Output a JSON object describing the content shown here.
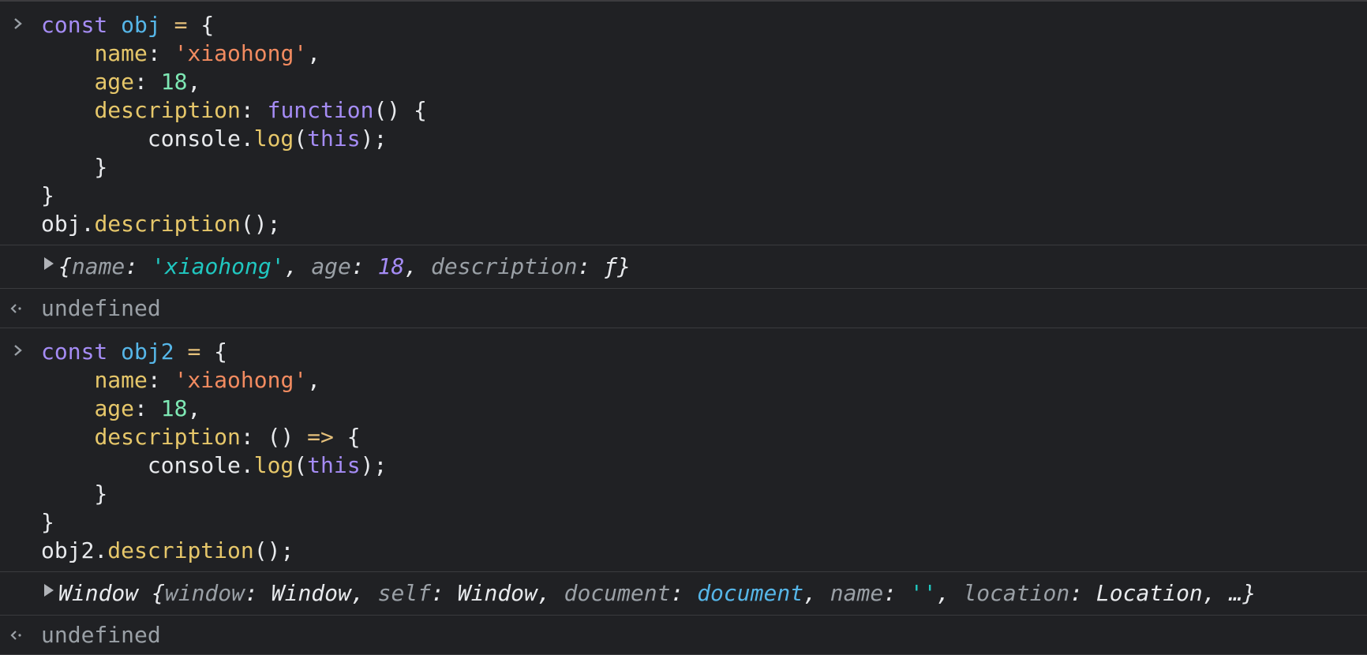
{
  "entries": [
    {
      "kind": "input",
      "lines": [
        [
          {
            "t": "const ",
            "c": "kw"
          },
          {
            "t": "obj",
            "c": "var"
          },
          {
            "t": " = ",
            "c": "op"
          },
          {
            "t": "{",
            "c": "plain"
          }
        ],
        [
          {
            "t": "    ",
            "c": "plain"
          },
          {
            "t": "name",
            "c": "prop"
          },
          {
            "t": ": ",
            "c": "plain"
          },
          {
            "t": "'xiaohong'",
            "c": "str"
          },
          {
            "t": ",",
            "c": "plain"
          }
        ],
        [
          {
            "t": "    ",
            "c": "plain"
          },
          {
            "t": "age",
            "c": "prop"
          },
          {
            "t": ": ",
            "c": "plain"
          },
          {
            "t": "18",
            "c": "num"
          },
          {
            "t": ",",
            "c": "plain"
          }
        ],
        [
          {
            "t": "    ",
            "c": "plain"
          },
          {
            "t": "description",
            "c": "prop"
          },
          {
            "t": ": ",
            "c": "plain"
          },
          {
            "t": "function",
            "c": "kw"
          },
          {
            "t": "() {",
            "c": "plain"
          }
        ],
        [
          {
            "t": "        console.",
            "c": "plain"
          },
          {
            "t": "log",
            "c": "fn"
          },
          {
            "t": "(",
            "c": "plain"
          },
          {
            "t": "this",
            "c": "this"
          },
          {
            "t": ");",
            "c": "plain"
          }
        ],
        [
          {
            "t": "    }",
            "c": "plain"
          }
        ],
        [
          {
            "t": "}",
            "c": "plain"
          }
        ],
        [
          {
            "t": "obj.",
            "c": "plain"
          },
          {
            "t": "description",
            "c": "fn"
          },
          {
            "t": "();",
            "c": "plain"
          }
        ]
      ]
    },
    {
      "kind": "log",
      "tokens": [
        {
          "t": "{",
          "c": "plain"
        },
        {
          "t": "name",
          "c": "pkey"
        },
        {
          "t": ": ",
          "c": "plain"
        },
        {
          "t": "'xiaohong'",
          "c": "pstr"
        },
        {
          "t": ", ",
          "c": "plain"
        },
        {
          "t": "age",
          "c": "pkey"
        },
        {
          "t": ": ",
          "c": "plain"
        },
        {
          "t": "18",
          "c": "pnum"
        },
        {
          "t": ", ",
          "c": "plain"
        },
        {
          "t": "description",
          "c": "pkey"
        },
        {
          "t": ": ",
          "c": "plain"
        },
        {
          "t": "ƒ",
          "c": "plain"
        },
        {
          "t": "}",
          "c": "plain"
        }
      ]
    },
    {
      "kind": "result",
      "text": "undefined"
    },
    {
      "kind": "input",
      "lines": [
        [
          {
            "t": "const ",
            "c": "kw"
          },
          {
            "t": "obj2",
            "c": "var"
          },
          {
            "t": " = ",
            "c": "op"
          },
          {
            "t": "{",
            "c": "plain"
          }
        ],
        [
          {
            "t": "    ",
            "c": "plain"
          },
          {
            "t": "name",
            "c": "prop"
          },
          {
            "t": ": ",
            "c": "plain"
          },
          {
            "t": "'xiaohong'",
            "c": "str"
          },
          {
            "t": ",",
            "c": "plain"
          }
        ],
        [
          {
            "t": "    ",
            "c": "plain"
          },
          {
            "t": "age",
            "c": "prop"
          },
          {
            "t": ": ",
            "c": "plain"
          },
          {
            "t": "18",
            "c": "num"
          },
          {
            "t": ",",
            "c": "plain"
          }
        ],
        [
          {
            "t": "    ",
            "c": "plain"
          },
          {
            "t": "description",
            "c": "prop"
          },
          {
            "t": ": () ",
            "c": "plain"
          },
          {
            "t": "=>",
            "c": "op"
          },
          {
            "t": " {",
            "c": "plain"
          }
        ],
        [
          {
            "t": "        console.",
            "c": "plain"
          },
          {
            "t": "log",
            "c": "fn"
          },
          {
            "t": "(",
            "c": "plain"
          },
          {
            "t": "this",
            "c": "this"
          },
          {
            "t": ");",
            "c": "plain"
          }
        ],
        [
          {
            "t": "    }",
            "c": "plain"
          }
        ],
        [
          {
            "t": "}",
            "c": "plain"
          }
        ],
        [
          {
            "t": "obj2.",
            "c": "plain"
          },
          {
            "t": "description",
            "c": "fn"
          },
          {
            "t": "();",
            "c": "plain"
          }
        ]
      ]
    },
    {
      "kind": "log",
      "tokens": [
        {
          "t": "Window {",
          "c": "plain"
        },
        {
          "t": "window",
          "c": "pkey"
        },
        {
          "t": ": Window, ",
          "c": "plain"
        },
        {
          "t": "self",
          "c": "pkey"
        },
        {
          "t": ": Window, ",
          "c": "plain"
        },
        {
          "t": "document",
          "c": "pkey"
        },
        {
          "t": ": ",
          "c": "plain"
        },
        {
          "t": "document",
          "c": "plink"
        },
        {
          "t": ", ",
          "c": "plain"
        },
        {
          "t": "name",
          "c": "pkey"
        },
        {
          "t": ": ",
          "c": "plain"
        },
        {
          "t": "''",
          "c": "pstr"
        },
        {
          "t": ", ",
          "c": "plain"
        },
        {
          "t": "location",
          "c": "pkey"
        },
        {
          "t": ": Location, …}",
          "c": "plain"
        }
      ]
    },
    {
      "kind": "result",
      "text": "undefined"
    }
  ],
  "icons": {
    "prompt": "chevron-right-icon",
    "result": "return-arrow-icon",
    "expand": "expand-triangle-icon"
  }
}
